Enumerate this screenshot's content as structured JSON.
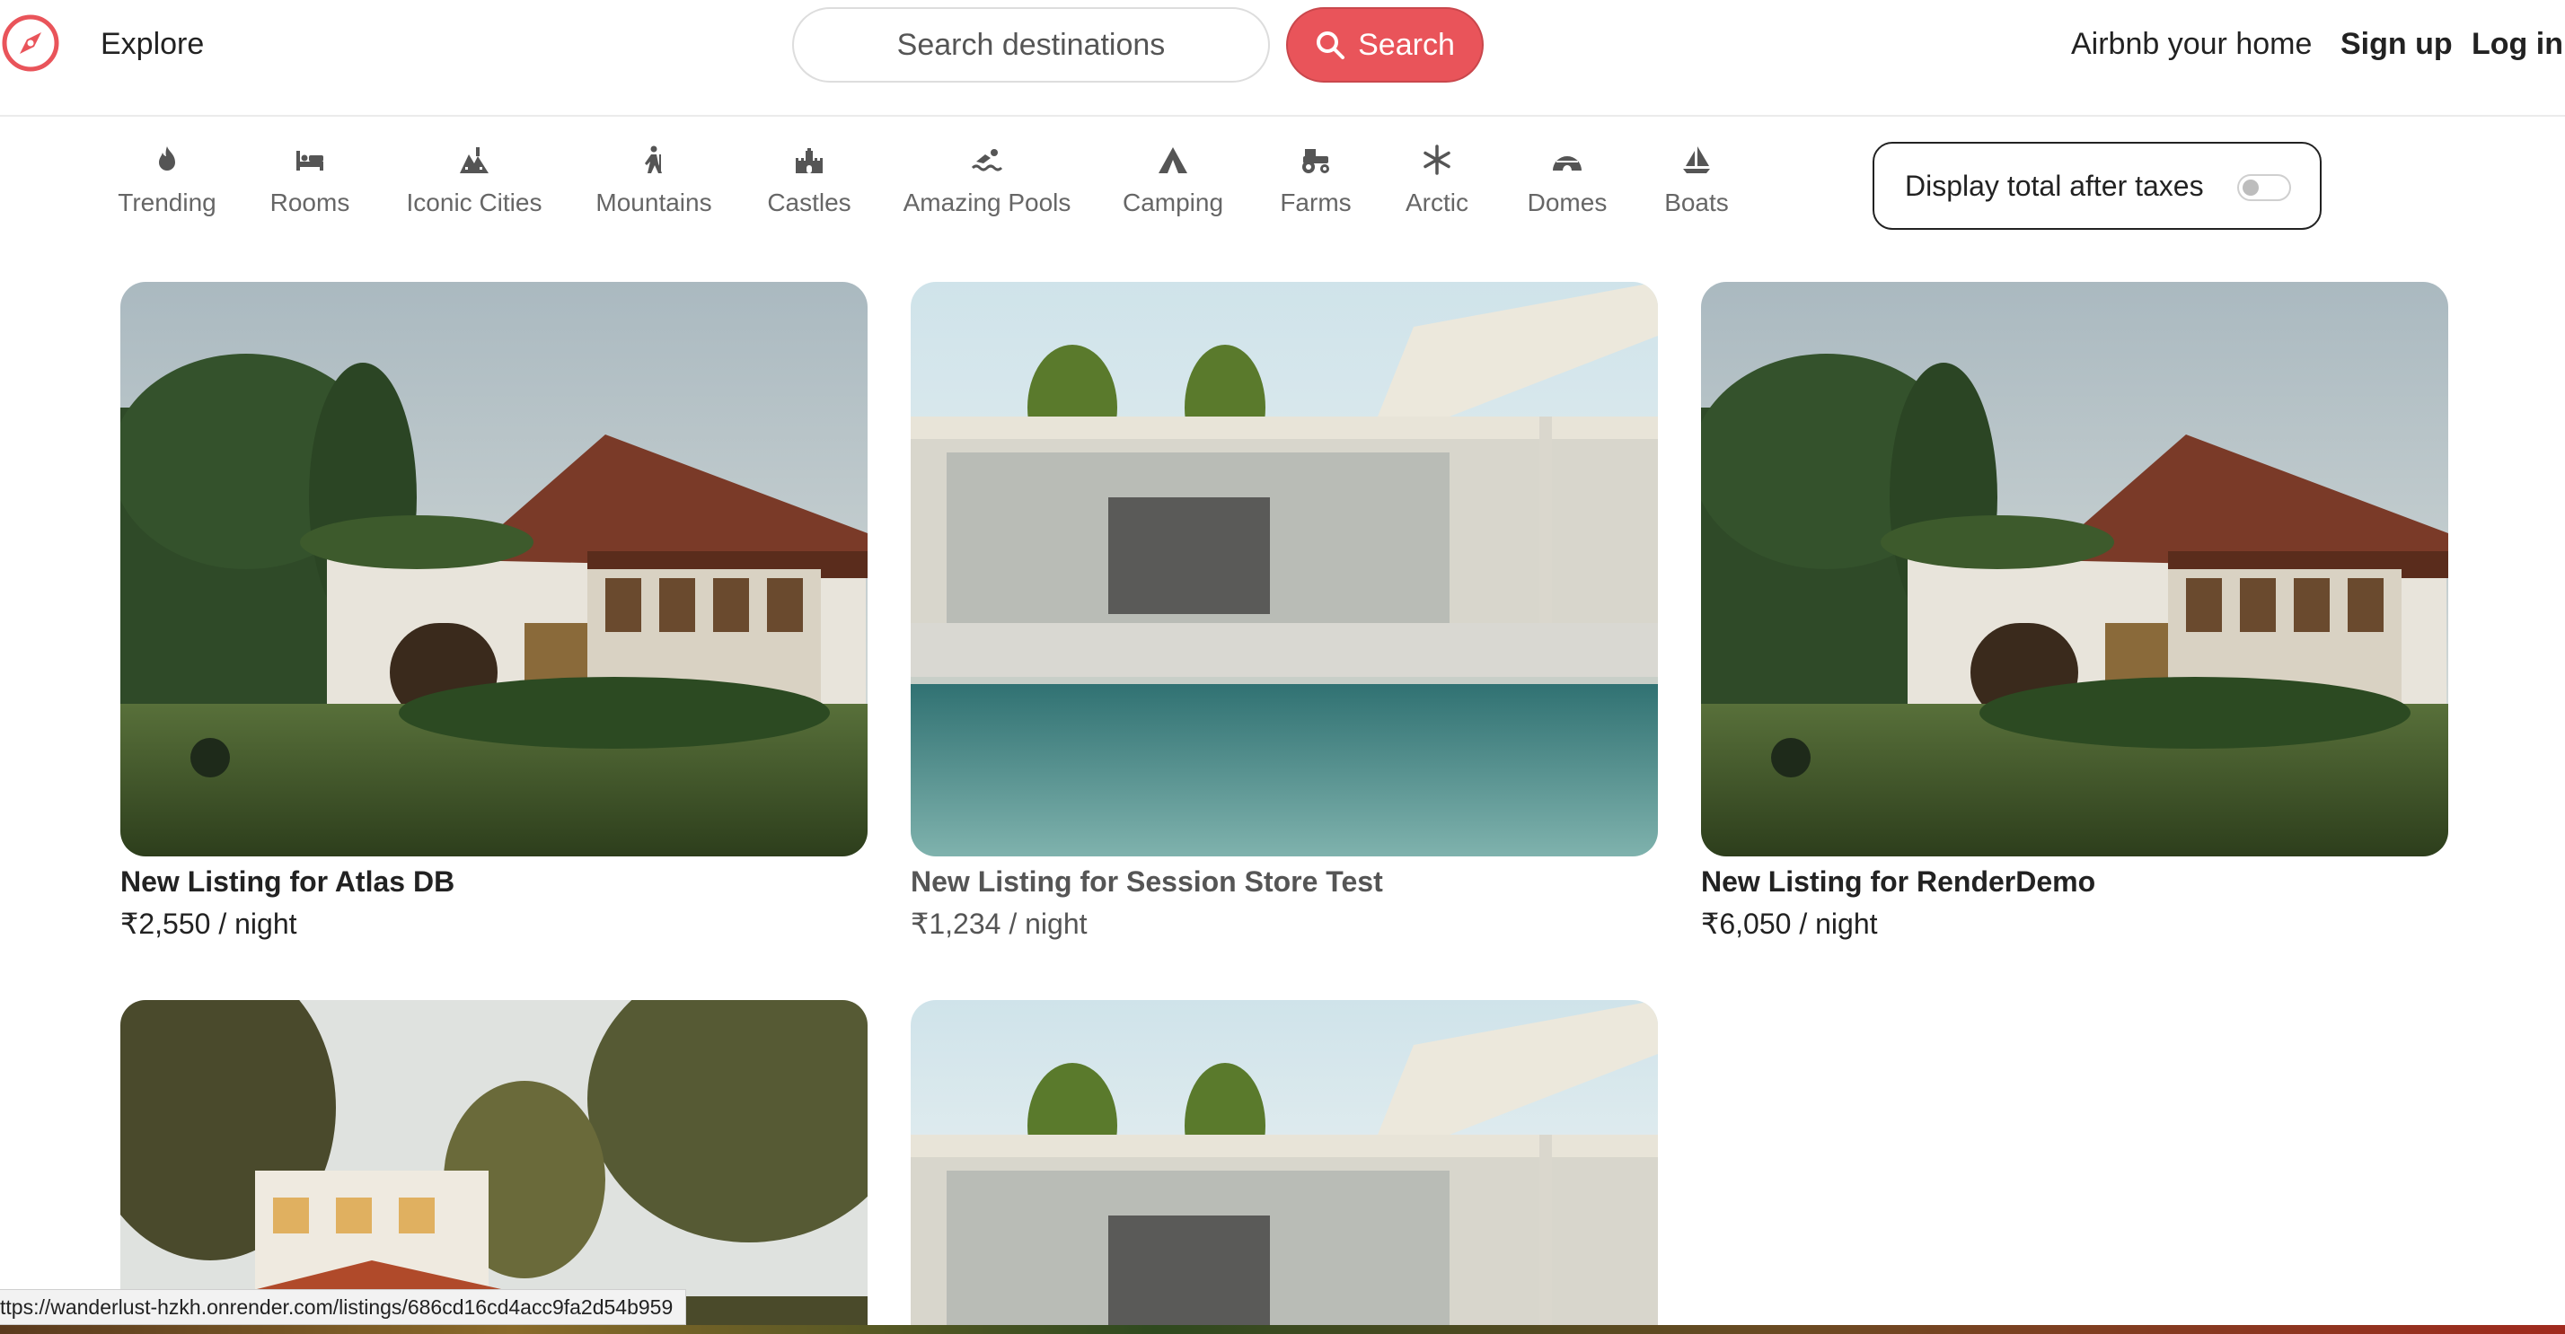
{
  "navbar": {
    "explore": "Explore",
    "search_placeholder": "Search destinations",
    "search_button": "Search",
    "host_link": "Airbnb your home",
    "signup": "Sign up",
    "login": "Log in",
    "brand_color": "#e9545a"
  },
  "filters": [
    {
      "label": "Trending",
      "icon": "fire-icon"
    },
    {
      "label": "Rooms",
      "icon": "bed-icon"
    },
    {
      "label": "Iconic Cities",
      "icon": "city-icon"
    },
    {
      "label": "Mountains",
      "icon": "mountain-icon"
    },
    {
      "label": "Castles",
      "icon": "castle-icon"
    },
    {
      "label": "Amazing Pools",
      "icon": "pool-icon"
    },
    {
      "label": "Camping",
      "icon": "tent-icon"
    },
    {
      "label": "Farms",
      "icon": "tractor-icon"
    },
    {
      "label": "Arctic",
      "icon": "snowflake-icon"
    },
    {
      "label": "Domes",
      "icon": "igloo-icon"
    },
    {
      "label": "Boats",
      "icon": "sailboat-icon"
    }
  ],
  "tax_toggle": {
    "label": "Display total after taxes",
    "enabled": false
  },
  "listings": [
    {
      "title": "New Listing for Atlas DB",
      "price": "₹2,550 / night",
      "photo": "tropical-villa"
    },
    {
      "title": "New Listing for Session Store Test",
      "price": "₹1,234 / night",
      "photo": "modern-pool-house"
    },
    {
      "title": "New Listing for RenderDemo",
      "price": "₹6,050 / night",
      "photo": "tropical-villa"
    },
    {
      "title": "",
      "price": "",
      "photo": "heritage-villa"
    },
    {
      "title": "",
      "price": "",
      "photo": "modern-pool-house"
    }
  ],
  "status_url": "ttps://wanderlust-hzkh.onrender.com/listings/686cd16cd4acc9fa2d54b959"
}
